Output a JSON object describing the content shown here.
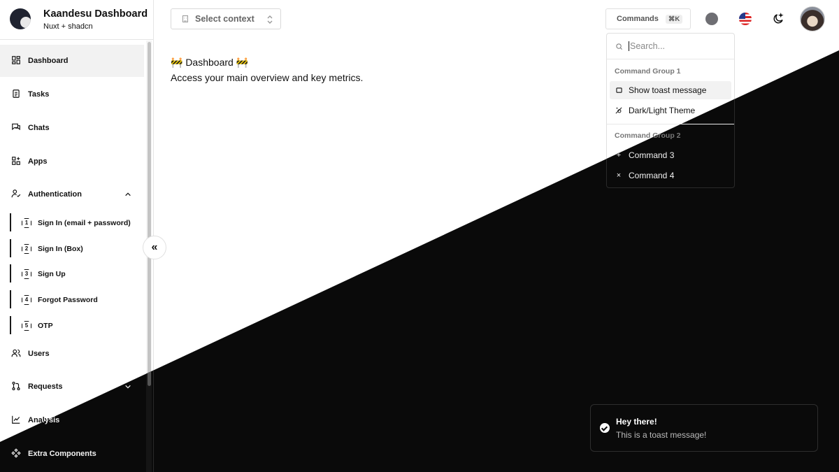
{
  "brand": {
    "title": "Kaandesu Dashboard",
    "subtitle": "Nuxt + shadcn"
  },
  "sidebar": {
    "items": [
      {
        "label": "Dashboard",
        "icon": "layout-dashboard-icon"
      },
      {
        "label": "Tasks",
        "icon": "clipboard-list-icon"
      },
      {
        "label": "Chats",
        "icon": "messages-icon"
      },
      {
        "label": "Apps",
        "icon": "apps-grid-plus-icon"
      },
      {
        "label": "Authentication",
        "icon": "user-check-icon"
      },
      {
        "label": "Users",
        "icon": "users-icon"
      },
      {
        "label": "Requests",
        "icon": "git-pull-request-icon"
      },
      {
        "label": "Analysis",
        "icon": "chart-line-icon"
      },
      {
        "label": "Extra Components",
        "icon": "components-icon"
      }
    ],
    "auth_sub_items": [
      {
        "badge": "1",
        "label": "Sign In (email + password)"
      },
      {
        "badge": "2",
        "label": "Sign In (Box)"
      },
      {
        "badge": "3",
        "label": "Sign Up"
      },
      {
        "badge": "4",
        "label": "Forgot Password"
      },
      {
        "badge": "5",
        "label": "OTP"
      }
    ],
    "collapse_glyph": "«"
  },
  "header": {
    "context_placeholder": "Select context",
    "commands_label": "Commands",
    "commands_shortcut": "⌘K"
  },
  "main": {
    "title": "🚧 Dashboard 🚧",
    "description": "Access your main overview and key metrics."
  },
  "command_palette": {
    "search_placeholder": "Search...",
    "group1_label": "Command Group 1",
    "group1_items": [
      "Show toast message",
      "Dark/Light Theme"
    ],
    "group2_label": "Command Group 2",
    "group2_items": [
      "Command 3",
      "Command 4"
    ]
  },
  "toast": {
    "title": "Hey there!",
    "message": "This is a toast message!"
  },
  "colors": {
    "light_bg": "#ffffff",
    "dark_bg": "#0a0a0a",
    "accent_active": "#f2f2f2"
  }
}
